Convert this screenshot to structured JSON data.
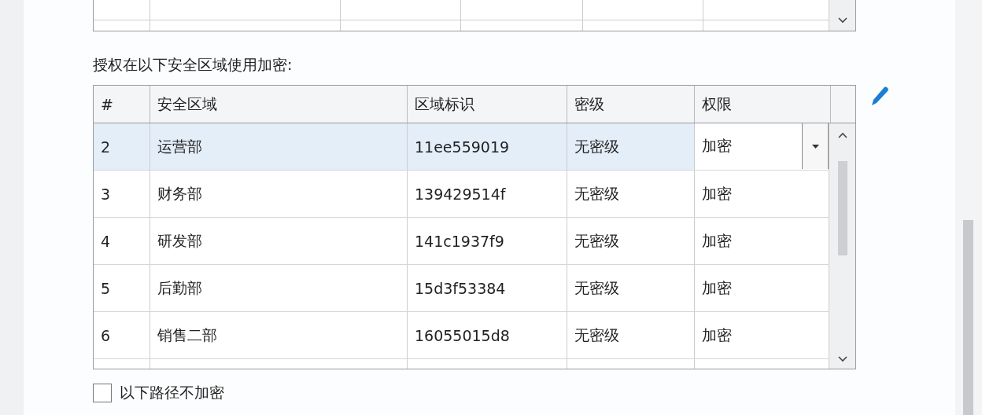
{
  "section_label": "授权在以下安全区域使用加密:",
  "zones_table": {
    "columns": [
      "#",
      "安全区域",
      "区域标识",
      "密级",
      "权限"
    ],
    "rows": [
      {
        "index": "2",
        "zone": "运营部",
        "zone_id": "11ee559019",
        "level": "无密级",
        "permission": "加密",
        "selected": true
      },
      {
        "index": "3",
        "zone": "财务部",
        "zone_id": "139429514f",
        "level": "无密级",
        "permission": "加密",
        "selected": false
      },
      {
        "index": "4",
        "zone": "研发部",
        "zone_id": "141c1937f9",
        "level": "无密级",
        "permission": "加密",
        "selected": false
      },
      {
        "index": "5",
        "zone": "后勤部",
        "zone_id": "15d3f53384",
        "level": "无密级",
        "permission": "加密",
        "selected": false
      },
      {
        "index": "6",
        "zone": "销售二部",
        "zone_id": "16055015d8",
        "level": "无密级",
        "permission": "加密",
        "selected": false
      }
    ]
  },
  "exclude_paths": {
    "label": "以下路径不加密",
    "checked": false
  }
}
